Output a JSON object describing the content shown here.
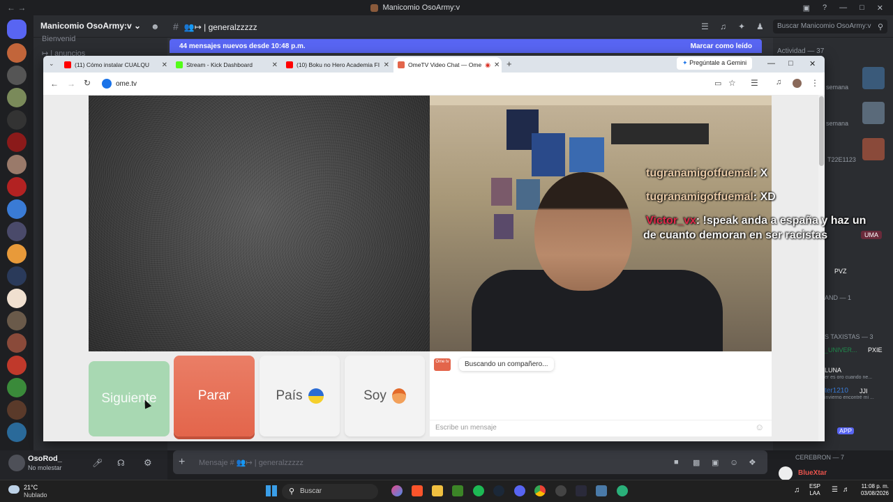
{
  "discord": {
    "window_title": "Manicomio OsoArmy:v",
    "server_name": "Manicomio OsoArmy:v",
    "channel_name": "👥↦ | generalzzzzz",
    "search_placeholder": "Buscar Manicomio OsoArmy:v",
    "channel_items": [
      "Bienvenid",
      "↦ | anuncios"
    ],
    "new_messages_text": "44 mensajes nuevos desde 10:48 p.m.",
    "mark_read_label": "Marcar como leído",
    "activity_header": "Actividad — 37",
    "member_snippets": [
      "semana",
      "semana",
      "T22E1123",
      "UMA",
      "PVZ",
      "AND — 1",
      "S TAXISTAS — 3",
      "_UNIVER...",
      "PXIE",
      "LUNA",
      "er es oro cuando ne...",
      "ter1210",
      "JJI",
      "invierno encontré mi ...",
      "APP"
    ],
    "cerebro_header": "CEREBRON — 7",
    "bottom_member": "BlueXtar",
    "user": {
      "name": "OsoRod_",
      "status": "No molestar"
    },
    "message_placeholder": "Mensaje # 👥↦ | generalzzzzz"
  },
  "browser": {
    "tabs": [
      {
        "label": "(11) Cómo instalar CUALQU",
        "icon_color": "#ff0000",
        "active": false
      },
      {
        "label": "Stream - Kick Dashboard",
        "icon_color": "#53fc18",
        "active": false
      },
      {
        "label": "(10) Boku no Hero Academia FI",
        "icon_color": "#ff0000",
        "active": false
      },
      {
        "label": "OmeTV Video Chat — Ome",
        "icon_color": "#e3654b",
        "active": true
      }
    ],
    "gemini_label": "Pregúntale a Gemini",
    "url": "ome.tv"
  },
  "ometv": {
    "stream_chat": [
      {
        "user": "tugranamigotfuemal",
        "text": ": X"
      },
      {
        "user": "tugranamigotfuemal",
        "text": ": XD"
      },
      {
        "user": "Victor_vx",
        "text": ": !speak anda a españa y haz un"
      },
      {
        "user": "",
        "text": "de cuanto demoran en ser racistas"
      }
    ],
    "buttons": {
      "next": "Siguiente",
      "stop": "Parar",
      "country": "País",
      "gender": "Soy"
    },
    "status_message": "Buscando un compañero...",
    "message_placeholder": "Escribe un mensaje",
    "logo_text": "Ome tv"
  },
  "taskbar": {
    "temperature": "21°C",
    "condition": "Nublado",
    "search_label": "Buscar",
    "language": "ESP",
    "language_sub": "LAA",
    "time": "11:08 p. m.",
    "date": "03/08/2026"
  },
  "colors": {
    "discord_accent": "#5865f2",
    "ome_stop": "#e3654b",
    "ome_next": "#a8d8b2"
  }
}
